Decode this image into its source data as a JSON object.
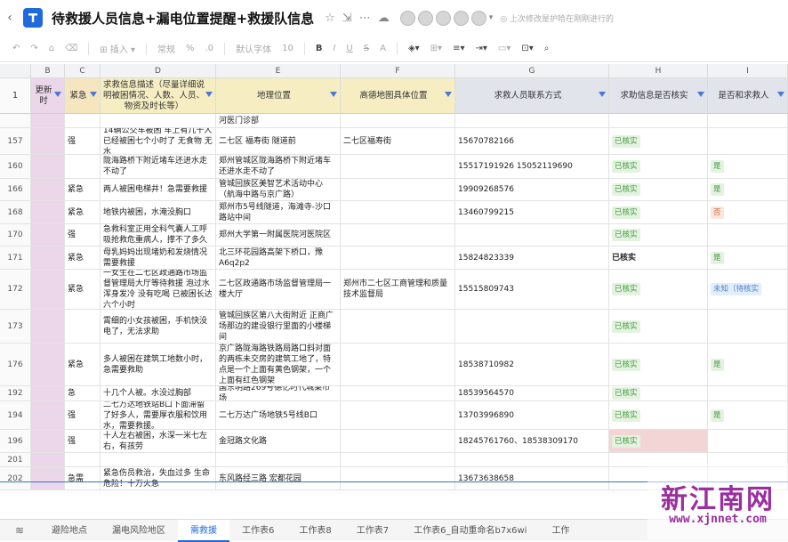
{
  "app": {
    "title": "待救援人员信息+漏电位置提醒+救援队信息",
    "save_status": "上次修改是护哈在刚刚进行的"
  },
  "toolbar": {
    "insert_label": "插入",
    "format_label": "常规",
    "font_label": "默认字体",
    "font_size": "10"
  },
  "columns": [
    "B",
    "C",
    "D",
    "E",
    "F",
    "G",
    "H",
    "I"
  ],
  "headers": [
    "更新时",
    "紧急",
    "求救信息描述（尽量详细说明被困情况、人数、人员、物资及时长等）",
    "地理位置",
    "高德地图具体位置",
    "求救人员联系方式",
    "求助信息是否核实",
    "是否和求救人"
  ],
  "header_row_num": "1",
  "top_partial": {
    "loc": "河医门诊部"
  },
  "rows": [
    {
      "num": "157",
      "urgency": "强",
      "desc": "14辆公交车被困 车上有几十人 已经被困七个小时了 无食物 无水",
      "loc": "二七区 福寿街 隧道前",
      "amap": "二七区福寿街",
      "contact": "15670782166",
      "verified": "已核实",
      "reached": ""
    },
    {
      "num": "160",
      "urgency": "",
      "desc": "陇海路桥下附近堵车还进水走不动了",
      "loc": "郑州管城区陇海路桥下附近堵车还进水走不动了",
      "amap": "",
      "contact": "15517191926 15052119690",
      "verified": "已核实",
      "reached": "是"
    },
    {
      "num": "166",
      "urgency": "紧急",
      "desc": "两人被困电梯井！急需要救援",
      "loc": "管城回族区美智艺术活动中心（航海中路与京广路）",
      "amap": "",
      "contact": "19909268576",
      "verified": "已核实",
      "reached": "是"
    },
    {
      "num": "168",
      "urgency": "紧急",
      "desc": "地铁内被困，水淹没胸口",
      "loc": "郑州市5号线隧道，海滩寺-沙口路站中间",
      "amap": "",
      "contact": "13460799215",
      "verified": "已核实",
      "reached": "否"
    },
    {
      "num": "170",
      "urgency": "强",
      "desc": "急救科室正用全科气囊人工呼吸抢救危重病人，撑不了多久",
      "loc": "郑州大学第一附属医院河医院区",
      "amap": "",
      "contact": "",
      "verified": "已核实",
      "reached": ""
    },
    {
      "num": "171",
      "urgency": "紧急",
      "desc": "母乳妈妈出现堵奶和发烧情况需要救援",
      "loc": "北三环花园路高架下桥口，豫A6q2p2",
      "amap": "",
      "contact": "15824823339",
      "verified": "已核实",
      "reached": "是"
    },
    {
      "num": "172",
      "urgency": "紧急",
      "desc": "一女生在二七区政通路市场监督管理局大厅等待救援 泡过水 浑身发冷 没有吃喝 已被困长达六个小时",
      "loc": "二七区政通路市场监督管理局一楼大厅",
      "amap": "郑州市二七区工商管理和质量技术监督局",
      "contact": "15515809743",
      "verified": "已核实",
      "reached": "未知（待核实"
    },
    {
      "num": "173",
      "urgency": "",
      "desc": "霄细的小女孩被困，手机快没电了，无法求助",
      "loc": "管城回族区第八大街附近 正商广场那边的建设银行里面的小楼梯间",
      "amap": "",
      "contact": "",
      "verified": "已核实",
      "reached": ""
    },
    {
      "num": "176",
      "urgency": "紧急",
      "desc": "多人被困在建筑工地数小时，急需要救助",
      "loc": "京广路陇海路铁路局路口斜对面的两栋未交房的建筑工地了，特点是一个上面有黄色钢架，一个上面有红色钢架",
      "amap": "",
      "contact": "18538710982",
      "verified": "已核实",
      "reached": "是"
    },
    {
      "num": "192",
      "urgency": "急",
      "desc": "十几个人被。水没过胸部",
      "loc": "国东明路269号德亿时代城菜市场",
      "amap": "",
      "contact": "18539564570",
      "verified": "已核实",
      "reached": ""
    },
    {
      "num": "194",
      "urgency": "强",
      "desc": "二七万达地铁站B口下面滞留了好多人，需要厚衣服和饮用水，需要救援。",
      "loc": "二七万达广场地铁5号线B口",
      "amap": "",
      "contact": "13703996890",
      "verified": "已核实",
      "reached": "是"
    },
    {
      "num": "196",
      "urgency": "强",
      "desc": "十人左右被困，水深一米七左右，有孩劳",
      "loc": "金冠路文化路",
      "amap": "",
      "contact": "18245761760、18538309170",
      "verified": "已核实",
      "reached": ""
    },
    {
      "num": "201",
      "urgency": "",
      "desc": "",
      "loc": "",
      "amap": "",
      "contact": "",
      "verified": "",
      "reached": ""
    },
    {
      "num": "202",
      "urgency": "急需",
      "desc": "紧急伤员救治，失血过多 生命危险！十万火急",
      "loc": "东风路经三路 宏都花园",
      "amap": "",
      "contact": "13673638658",
      "verified": "",
      "reached": ""
    }
  ],
  "tabs": [
    "避险地点",
    "漏电风险地区",
    "需救援",
    "工作表6",
    "工作表8",
    "工作表7",
    "工作表6_自动重命名b7x6wi",
    "工作"
  ],
  "active_tab": "需救援",
  "watermark": {
    "main": "新江南网",
    "url": "www.xjnnet.com"
  }
}
